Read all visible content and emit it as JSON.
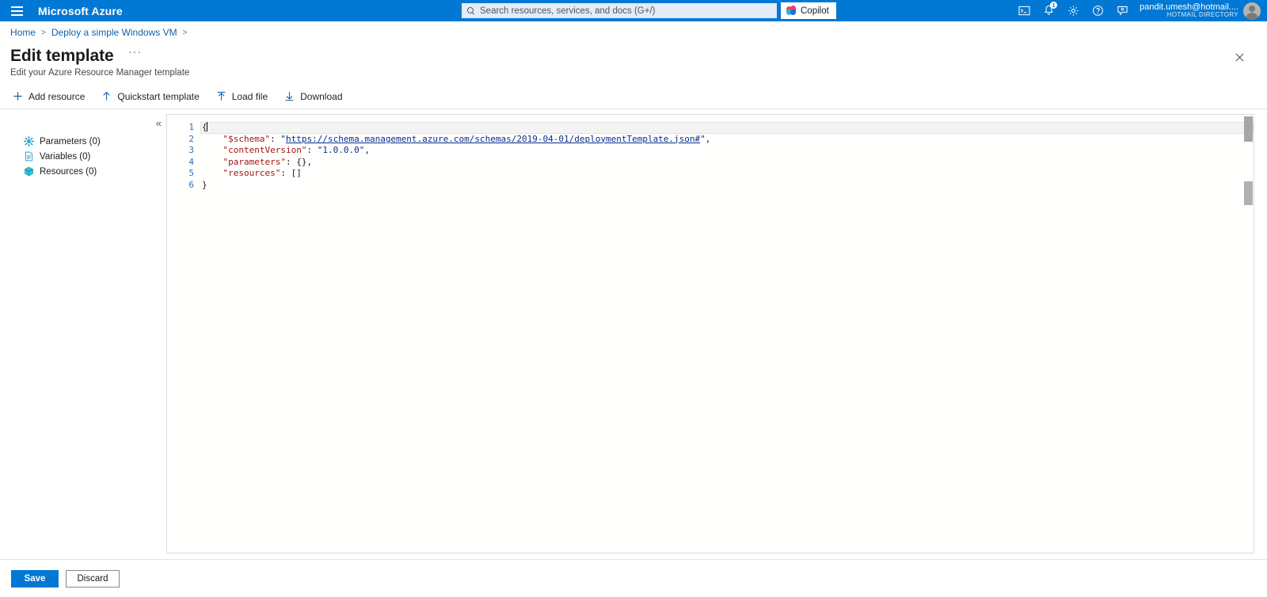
{
  "topbar": {
    "menu_icon": "hamburger-icon",
    "brand": "Microsoft Azure",
    "search": {
      "placeholder": "Search resources, services, and docs (G+/)",
      "value": "",
      "icon": "search-icon"
    },
    "copilot": {
      "label": "Copilot",
      "icon": "copilot-icon"
    },
    "icons": [
      {
        "name": "cloud-shell-icon",
        "title": "Cloud Shell"
      },
      {
        "name": "notifications-icon",
        "title": "Notifications",
        "badge": "1"
      },
      {
        "name": "settings-gear-icon",
        "title": "Settings"
      },
      {
        "name": "help-question-icon",
        "title": "Help"
      },
      {
        "name": "feedback-icon",
        "title": "Feedback"
      }
    ],
    "account": {
      "name": "pandit.umesh@hotmail....",
      "directory": "HOTMAIL DIRECTORY",
      "avatar": "user-avatar"
    }
  },
  "breadcrumb": {
    "items": [
      "Home",
      "Deploy a simple Windows VM"
    ],
    "separator": ">"
  },
  "page": {
    "title": "Edit template",
    "more_label": "···",
    "subtitle": "Edit your Azure Resource Manager template",
    "close_label": "Close"
  },
  "commands": [
    {
      "label": "Add resource",
      "icon": "plus-icon"
    },
    {
      "label": "Quickstart template",
      "icon": "arrow-up-icon"
    },
    {
      "label": "Load file",
      "icon": "upload-icon"
    },
    {
      "label": "Download",
      "icon": "download-icon"
    }
  ],
  "sidebar": {
    "collapse_label": "«",
    "items": [
      {
        "label": "Parameters (0)",
        "icon": "parameters-gear-icon"
      },
      {
        "label": "Variables (0)",
        "icon": "variables-page-icon"
      },
      {
        "label": "Resources (0)",
        "icon": "resources-cube-icon"
      }
    ]
  },
  "editor": {
    "line_numbers": [
      "1",
      "2",
      "3",
      "4",
      "5",
      "6"
    ],
    "lines": [
      {
        "indent": 0,
        "tokens": [
          {
            "t": "brace",
            "v": "{"
          }
        ],
        "current": true,
        "cursor": true
      },
      {
        "indent": 1,
        "tokens": [
          {
            "t": "prop",
            "v": "\"$schema\""
          },
          {
            "t": "punct",
            "v": ": "
          },
          {
            "t": "str",
            "v": "\""
          },
          {
            "t": "link",
            "v": "https://schema.management.azure.com/schemas/2019-04-01/deploymentTemplate.json#"
          },
          {
            "t": "str",
            "v": "\""
          },
          {
            "t": "punct",
            "v": ","
          }
        ]
      },
      {
        "indent": 1,
        "tokens": [
          {
            "t": "prop",
            "v": "\"contentVersion\""
          },
          {
            "t": "punct",
            "v": ": "
          },
          {
            "t": "str",
            "v": "\"1.0.0.0\""
          },
          {
            "t": "punct",
            "v": ","
          }
        ]
      },
      {
        "indent": 1,
        "tokens": [
          {
            "t": "prop",
            "v": "\"parameters\""
          },
          {
            "t": "punct",
            "v": ": "
          },
          {
            "t": "brace",
            "v": "{}"
          },
          {
            "t": "punct",
            "v": ","
          }
        ]
      },
      {
        "indent": 1,
        "tokens": [
          {
            "t": "prop",
            "v": "\"resources\""
          },
          {
            "t": "punct",
            "v": ": "
          },
          {
            "t": "brace",
            "v": "[]"
          }
        ]
      },
      {
        "indent": 0,
        "tokens": [
          {
            "t": "brace",
            "v": "}"
          }
        ]
      }
    ]
  },
  "footer": {
    "save_label": "Save",
    "discard_label": "Discard"
  },
  "colors": {
    "azure_blue": "#0078d4",
    "link_blue": "#0f62b0",
    "json_key": "#a31515",
    "json_string": "#0b2d8c"
  }
}
